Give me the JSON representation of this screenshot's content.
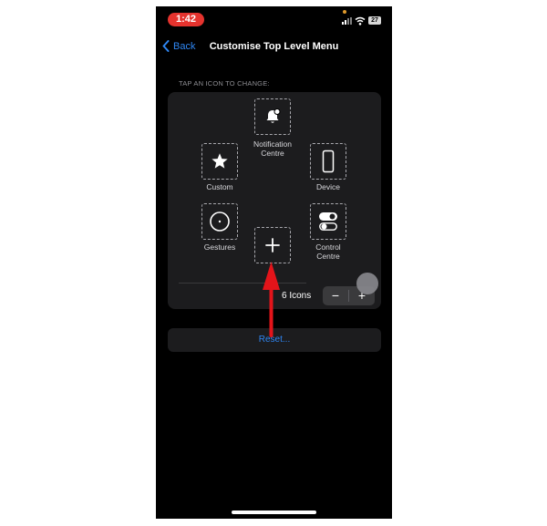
{
  "status_bar": {
    "time": "1:42",
    "battery": "27"
  },
  "nav": {
    "back_label": "Back",
    "title": "Customise Top Level Menu"
  },
  "section_label": "TAP AN ICON TO CHANGE:",
  "menu_items": [
    {
      "label": "Notification\nCentre",
      "icon": "bell-icon"
    },
    {
      "label": "Custom",
      "icon": "star-icon"
    },
    {
      "label": "Device",
      "icon": "phone-icon"
    },
    {
      "label": "Gestures",
      "icon": "circle-dot-icon"
    },
    {
      "label": "",
      "icon": "plus-icon"
    },
    {
      "label": "Control\nCentre",
      "icon": "toggles-icon"
    }
  ],
  "icon_count": {
    "label": "6 Icons",
    "minus": "−",
    "plus": "+"
  },
  "reset_label": "Reset...",
  "colors": {
    "accent": "#2f86f2",
    "annotation_arrow": "#e3141a",
    "time_pill": "#e5332e"
  }
}
